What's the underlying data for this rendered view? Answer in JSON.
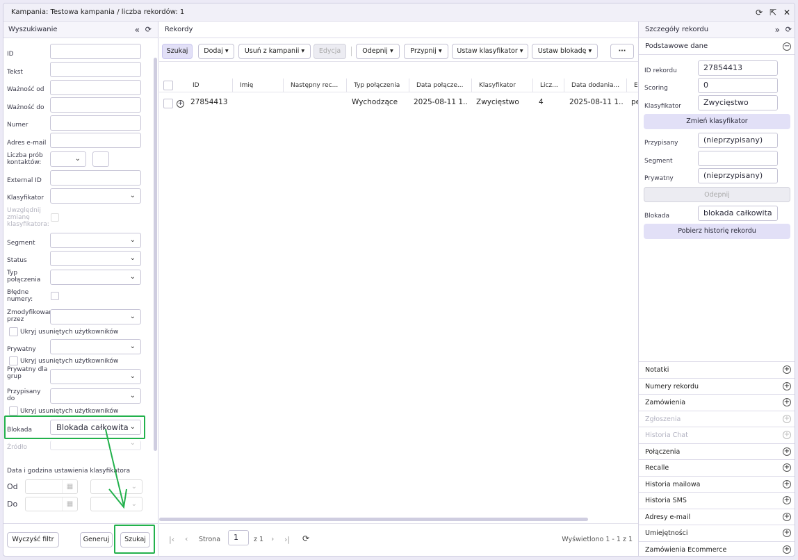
{
  "window": {
    "title": "Kampania: Testowa kampania / liczba rekordów: 1"
  },
  "left": {
    "title": "Wyszukiwanie",
    "labels": {
      "id": "ID",
      "tekst": "Tekst",
      "waznosc_od": "Ważność od",
      "waznosc_do": "Ważność do",
      "numer": "Numer",
      "email": "Adres e-mail",
      "proby": "Liczba prób kontaktów:",
      "external": "External ID",
      "klasyfikator": "Klasyfikator",
      "uwzglednij": "Uwzględnij zmianę klasyfikatora:",
      "segment": "Segment",
      "status": "Status",
      "typ": "Typ połączenia",
      "bledne": "Błędne numery:",
      "zmodyfikowany": "Zmodyfikowany przez",
      "ukryj1": "Ukryj usuniętych użytkowników",
      "prywatny": "Prywatny",
      "ukryj2": "Ukryj usuniętych użytkowników",
      "prywatny_grup": "Prywatny dla grup",
      "przypisany": "Przypisany do",
      "ukryj3": "Ukryj usuniętych użytkowników",
      "blokada": "Blokada",
      "zrodlo": "Źródło",
      "data_section": "Data i godzina ustawienia klasyfikatora",
      "od": "Od",
      "do": "Do"
    },
    "blokada_value": "Blokada całkowita",
    "buttons": {
      "clear": "Wyczyść filtr",
      "generate": "Generuj",
      "search": "Szukaj"
    }
  },
  "center": {
    "title": "Rekordy",
    "toolbar": {
      "search": "Szukaj",
      "add": "Dodaj",
      "remove": "Usuń z kampanii",
      "edit": "Edycja",
      "unassign": "Odepnij",
      "assign": "Przypnij",
      "set_classifier": "Ustaw klasyfikator",
      "set_block": "Ustaw blokadę",
      "more": "···"
    },
    "columns": [
      "ID",
      "Imię",
      "Następny rec...",
      "Typ połączenia",
      "Data połącze...",
      "Klasyfikator",
      "Licz...",
      "Data dodania...",
      "E"
    ],
    "rows": [
      [
        "27854413",
        "",
        "",
        "Wychodzące",
        "2025-08-11 1...",
        "Zwycięstwo",
        "4",
        "2025-08-11 1...",
        "pe"
      ]
    ],
    "pager": {
      "label": "Strona",
      "page": "1",
      "of": "z 1",
      "displayed": "Wyświetlono 1 - 1 z 1"
    }
  },
  "right": {
    "title": "Szczegóły rekordu",
    "section": "Podstawowe dane",
    "fields": {
      "id_label": "ID rekordu",
      "id_value": "27854413",
      "scoring_label": "Scoring",
      "scoring_value": "0",
      "klas_label": "Klasyfikator",
      "klas_value": "Zwycięstwo",
      "przyp_label": "Przypisany",
      "przyp_value": "(nieprzypisany)",
      "segment_label": "Segment",
      "segment_value": "",
      "pryw_label": "Prywatny",
      "pryw_value": "(nieprzypisany)",
      "blok_label": "Blokada",
      "blok_value": "blokada całkowita"
    },
    "buttons": {
      "change": "Zmień klasyfikator",
      "unassign": "Odepnij",
      "history": "Pobierz historię rekordu"
    },
    "sections": [
      "Notatki",
      "Numery rekordu",
      "Zamówienia",
      "Zgłoszenia",
      "Historia Chat",
      "Połączenia",
      "Recalle",
      "Historia mailowa",
      "Historia SMS",
      "Adresy e-mail",
      "Umiejętności",
      "Zamówienia Ecommerce"
    ],
    "disabled_sections": [
      "Zgłoszenia",
      "Historia Chat"
    ]
  },
  "colors": {
    "accent": "#e2e0f7",
    "highlight": "#22b14c"
  }
}
